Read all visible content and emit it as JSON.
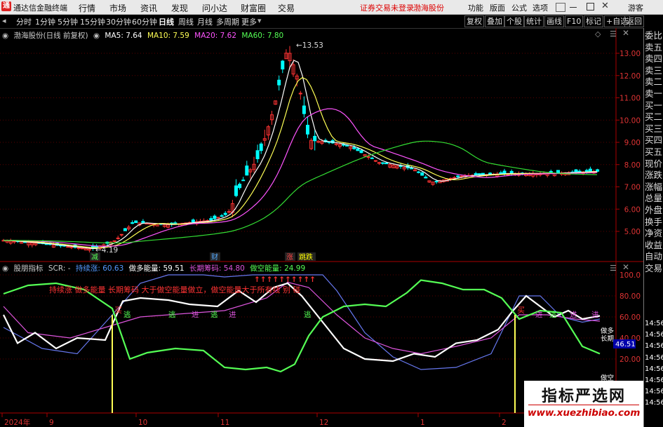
{
  "menubar": {
    "app_title": "通达信金融终端",
    "items": [
      "行情",
      "市场",
      "资讯",
      "发现",
      "问小达",
      "财富圈",
      "交易"
    ],
    "login_status": "证券交易未登录",
    "stock_name": "渤海股份",
    "right_items": [
      "功能",
      "版面",
      "公式",
      "选项"
    ],
    "user": "游客"
  },
  "toolbar": {
    "periods": [
      "分时",
      "1分钟",
      "5分钟",
      "15分钟",
      "30分钟",
      "60分钟",
      "日线",
      "周线",
      "月线",
      "多周期",
      "更多"
    ],
    "active_period": "日线",
    "right_buttons": [
      "复权",
      "叠加",
      "个股",
      "统计",
      "画线",
      "F10",
      "标记",
      "+自选",
      "返回"
    ]
  },
  "main_chart": {
    "title": "渤海股份(日线 前复权)",
    "ma": [
      {
        "label": "MA5: 7.64",
        "color": "#ffffff"
      },
      {
        "label": "MA10: 7.59",
        "color": "#ffff55"
      },
      {
        "label": "MA20: 7.62",
        "color": "#ff55ff"
      },
      {
        "label": "MA60: 7.80",
        "color": "#55ff55"
      }
    ],
    "price_ticks": [
      "13.00",
      "12.00",
      "11.00",
      "10.00",
      "9.00",
      "8.00",
      "7.00",
      "6.00",
      "5.00"
    ],
    "high_label": "13.53",
    "low_label": "4.19",
    "markers": [
      {
        "text": "减",
        "color": "#55ff55"
      },
      {
        "text": "财",
        "color": "#55aaff"
      },
      {
        "text": "涨",
        "color": "#ff4444"
      },
      {
        "text": "跳跌",
        "color": "#ffff00"
      }
    ]
  },
  "indicator": {
    "name": "股朋指标",
    "scr": "SCR: -",
    "lines": [
      {
        "label": "持续涨: 60.63",
        "color": "#5599ff"
      },
      {
        "label": "做多能量: 59.51",
        "color": "#ffffff"
      },
      {
        "label": "长期筹码: 54.80",
        "color": "#dd55dd"
      },
      {
        "label": "做空能量: 24.99",
        "color": "#55ff55"
      }
    ],
    "ticks": [
      "100.0",
      "80.00",
      "60.00",
      "40.00",
      "20.00"
    ],
    "annotation": "持续涨 做多能量 长期筹码 大于做空能量做立，做空能量大于所有线 别 碰",
    "arrows": "↑↑↑↑↑↑↑↑↑↑",
    "signals": [
      "逃",
      "逃",
      "进",
      "逃",
      "进",
      "逃",
      "进",
      "逃",
      "进",
      "进"
    ],
    "buy_labels": [
      "买",
      "买"
    ],
    "right_labels": [
      "做多",
      "长期",
      "做空"
    ],
    "value_box": "46.51"
  },
  "xaxis": [
    "2024年",
    "9",
    "10",
    "11",
    "12",
    "1",
    "2"
  ],
  "sidepanel": {
    "items": [
      "委比",
      "卖五",
      "卖四",
      "卖三",
      "卖二",
      "卖一",
      "买一",
      "买二",
      "买三",
      "买四",
      "买五",
      "现价",
      "涨跌",
      "涨幅",
      "总量",
      "外盘",
      "换手",
      "净资",
      "收益",
      "自动",
      "交易"
    ],
    "times": [
      "14:56",
      "14:56",
      "14:56",
      "14:56",
      "14:56",
      "14:56",
      "14:56",
      "14:56"
    ]
  },
  "watermark": {
    "line1": "指标严选网",
    "line2": "www.xuezhibiao.com"
  },
  "colors": {
    "up": "#ff3333",
    "down": "#00ffff",
    "grid": "#7a0000"
  }
}
